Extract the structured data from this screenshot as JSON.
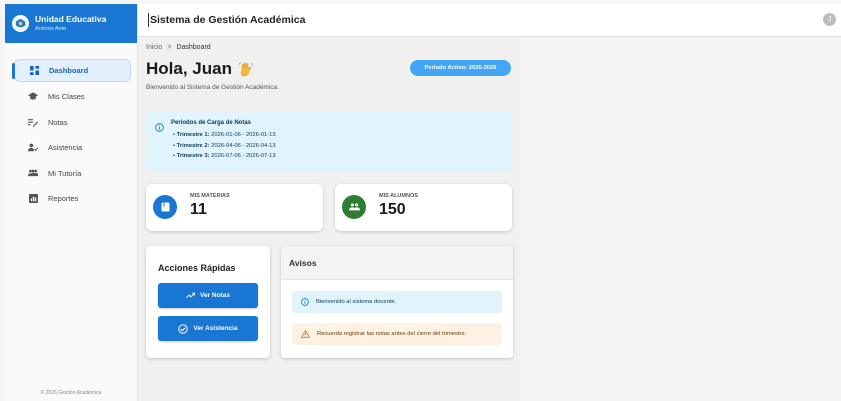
{
  "sidebar": {
    "brand_name": "Unidad Educativa",
    "user_name": "Antonio Ante",
    "items": [
      {
        "label": "Dashboard",
        "icon": "dashboard-icon",
        "active": true
      },
      {
        "label": "Mis Clases",
        "icon": "school-icon"
      },
      {
        "label": "Notas",
        "icon": "grades-icon"
      },
      {
        "label": "Asistencia",
        "icon": "attendance-icon"
      },
      {
        "label": "Mi Tutoría",
        "icon": "group-icon"
      },
      {
        "label": "Reportes",
        "icon": "reports-icon"
      }
    ],
    "footer": "© 2026 Gestión Académica"
  },
  "header": {
    "title": "Sistema de Gestión Académica",
    "avatar_initial": "J"
  },
  "main": {
    "breadcrumb": {
      "home": "Inicio",
      "separator": ">",
      "current": "Dashboard"
    },
    "greeting": "Hola, Juan",
    "subtitle": "Bienvenido al Sistema de Gestión Académica.",
    "period_chip": "Periodo Activo: 2025-2026",
    "info": {
      "title": "Periodos de Carga de Notas",
      "trimesters": [
        {
          "label": "Trimestre 1:",
          "range": "2026-01-06 - 2026-01-13"
        },
        {
          "label": "Trimestre 2:",
          "range": "2026-04-06 - 2026-04-13"
        },
        {
          "label": "Trimestre 3:",
          "range": "2026-07-06 - 2026-07-13"
        }
      ]
    },
    "stats": [
      {
        "label": "MIS MATERIAS",
        "value": "11",
        "color": "#1976d2"
      },
      {
        "label": "MIS ALUMNOS",
        "value": "150",
        "color": "#2e7d32"
      }
    ],
    "quick_actions": {
      "title": "Acciones Rápidas",
      "buttons": [
        "Ver Notas",
        "Ver Asistencia"
      ]
    },
    "notices": {
      "title": "Avisos",
      "items": [
        {
          "text": "Bienvenido al sistema docente.",
          "type": "info"
        },
        {
          "text": "Recuerda registrar las notas antes del cierre del trimestre.",
          "type": "warning"
        }
      ]
    }
  },
  "colors": {
    "primary": "#1976d2",
    "success": "#2e7d32",
    "chip": "#42a5f5",
    "info_bg": "#e1f3fb",
    "warn_bg": "#fdf1e3"
  }
}
